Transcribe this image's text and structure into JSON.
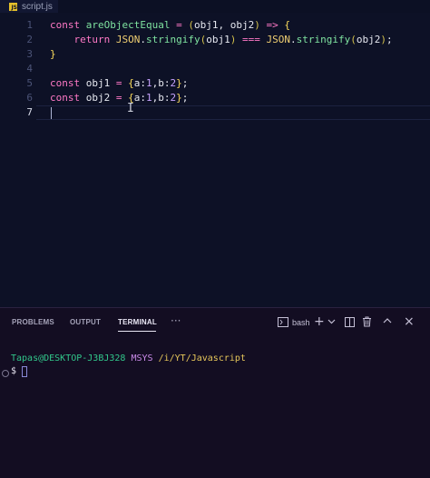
{
  "tab": {
    "icon": "js-file-icon",
    "label": "script.js"
  },
  "editor": {
    "line_numbers": [
      "1",
      "2",
      "3",
      "4",
      "5",
      "6",
      "7"
    ],
    "active_line": "7"
  },
  "panel": {
    "tabs": [
      "PROBLEMS",
      "OUTPUT",
      "TERMINAL"
    ],
    "active_tab": "TERMINAL",
    "more": "···",
    "shell": "bash",
    "terminal": {
      "user_host": "Tapas@DESKTOP-J3BJ328",
      "env": "MSYS",
      "path": "/i/YT/Javascript",
      "prompt": "$"
    }
  },
  "colors": {
    "accent": "#ff79c6",
    "editor_bg": "#0d1126",
    "panel_bg": "#130d22"
  }
}
